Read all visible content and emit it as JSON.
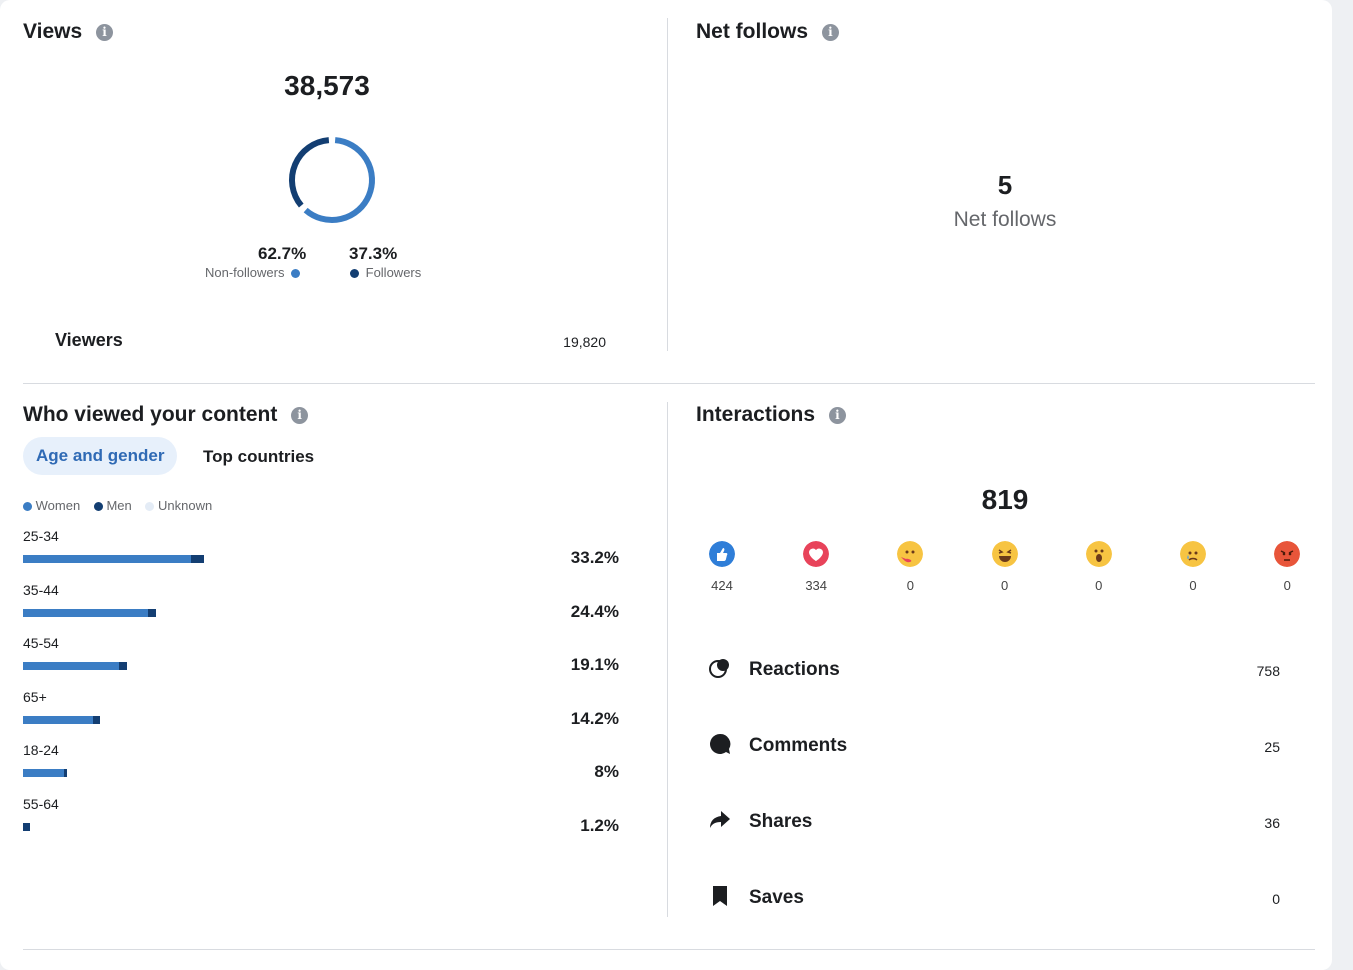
{
  "views": {
    "title": "Views",
    "info_icon": "i",
    "total": "38,573",
    "non_followers_pct": "62.7%",
    "non_followers_label": "Non-followers",
    "followers_pct": "37.3%",
    "followers_label": "Followers",
    "viewers_label": "Viewers",
    "viewers_value": "19,820",
    "donut": {
      "non_followers_fraction": 0.627,
      "followers_fraction": 0.373,
      "non_followers_color": "#3b7dc4",
      "followers_color": "#133e72"
    }
  },
  "net_follows": {
    "title": "Net follows",
    "info_icon": "i",
    "value": "5",
    "label": "Net follows"
  },
  "who_viewed": {
    "title": "Who viewed your content",
    "info_icon": "i",
    "tabs": [
      "Age and gender",
      "Top countries"
    ],
    "active_tab": "Age and gender",
    "legend": [
      {
        "label": "Women",
        "color": "#3b7dc4"
      },
      {
        "label": "Men",
        "color": "#133e72"
      },
      {
        "label": "Unknown",
        "color": "#e4ecf6"
      }
    ],
    "rows": [
      {
        "age": "25-34",
        "pct": "33.2%",
        "women": 0.93,
        "men": 0.07,
        "total": 33.2
      },
      {
        "age": "35-44",
        "pct": "24.4%",
        "women": 0.94,
        "men": 0.06,
        "total": 24.4
      },
      {
        "age": "45-54",
        "pct": "19.1%",
        "women": 0.92,
        "men": 0.08,
        "total": 19.1
      },
      {
        "age": "65+",
        "pct": "14.2%",
        "women": 0.9,
        "men": 0.1,
        "total": 14.2
      },
      {
        "age": "18-24",
        "pct": "8%",
        "women": 0.94,
        "men": 0.06,
        "total": 8
      },
      {
        "age": "55-64",
        "pct": "1.2%",
        "women": 0.0,
        "men": 1.0,
        "total": 1.2
      }
    ]
  },
  "interactions": {
    "title": "Interactions",
    "info_icon": "i",
    "total": "819",
    "reactions": [
      {
        "icon": "like-icon",
        "count": "424",
        "color": "#2f7ed8"
      },
      {
        "icon": "love-icon",
        "count": "334",
        "color": "#e8435a"
      },
      {
        "icon": "care-icon",
        "count": "0",
        "color": "#f7c442"
      },
      {
        "icon": "haha-icon",
        "count": "0",
        "color": "#f7c442"
      },
      {
        "icon": "wow-icon",
        "count": "0",
        "color": "#f7c442"
      },
      {
        "icon": "sad-icon",
        "count": "0",
        "color": "#f7c442"
      },
      {
        "icon": "angry-icon",
        "count": "0",
        "color": "#e8553a"
      }
    ],
    "breakdown": [
      {
        "icon": "reactions-icon",
        "label": "Reactions",
        "value": "758"
      },
      {
        "icon": "comments-icon",
        "label": "Comments",
        "value": "25"
      },
      {
        "icon": "shares-icon",
        "label": "Shares",
        "value": "36"
      },
      {
        "icon": "saves-icon",
        "label": "Saves",
        "value": "0"
      }
    ]
  }
}
